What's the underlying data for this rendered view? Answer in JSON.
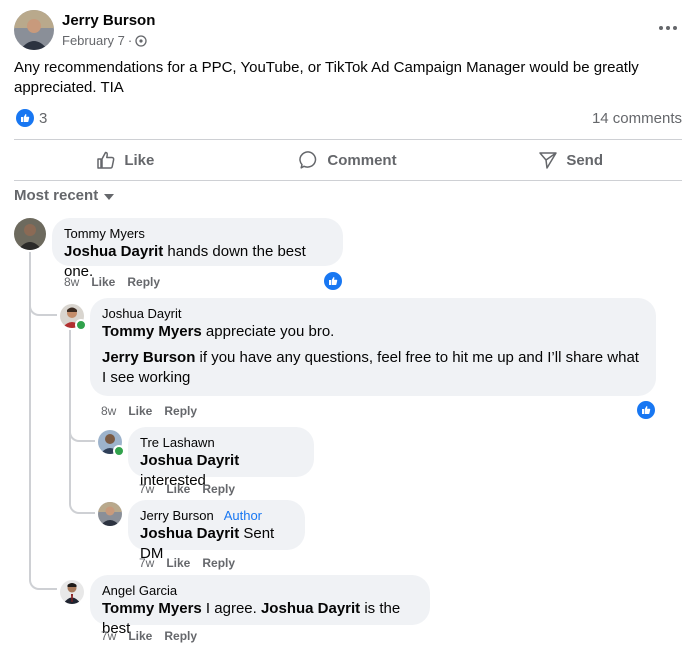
{
  "post": {
    "author": "Jerry Burson",
    "date": "February 7",
    "separator": "·",
    "privacy_icon": "globe-icon",
    "body": "Any recommendations for a PPC, YouTube, or TikTok Ad Campaign Manager would be greatly appreciated. TIA",
    "like_count": "3",
    "comments_count": "14 comments"
  },
  "actions": {
    "like": "Like",
    "comment": "Comment",
    "send": "Send"
  },
  "sort": {
    "label": "Most recent"
  },
  "comments": [
    {
      "name": "Tommy Myers",
      "mention": "Joshua Dayrit",
      "text": " hands down the best one.",
      "time": "8w",
      "like": "Like",
      "reply": "Reply"
    },
    {
      "name": "Joshua Dayrit",
      "mention1": "Tommy Myers",
      "text1": " appreciate you bro.",
      "mention2": "Jerry Burson",
      "text2": " if you have any questions, feel free to hit me up and I’ll share what I see working",
      "time": "8w",
      "like": "Like",
      "reply": "Reply"
    },
    {
      "name": "Tre Lashawn",
      "mention": "Joshua Dayrit",
      "text": " interested",
      "time": "7w",
      "like": "Like",
      "reply": "Reply"
    },
    {
      "name": "Jerry Burson",
      "badge": "Author",
      "mention": "Joshua Dayrit",
      "text": " Sent DM",
      "time": "7w",
      "like": "Like",
      "reply": "Reply"
    },
    {
      "name": "Angel Garcia",
      "mention1": "Tommy Myers",
      "text1": " I agree. ",
      "mention2": "Joshua Dayrit",
      "text2": " is the best",
      "time": "7w",
      "like": "Like",
      "reply": "Reply"
    }
  ],
  "colors": {
    "accent": "#1877f2",
    "bubble": "#f0f2f5",
    "muted": "#65676b",
    "online": "#31a24c"
  }
}
